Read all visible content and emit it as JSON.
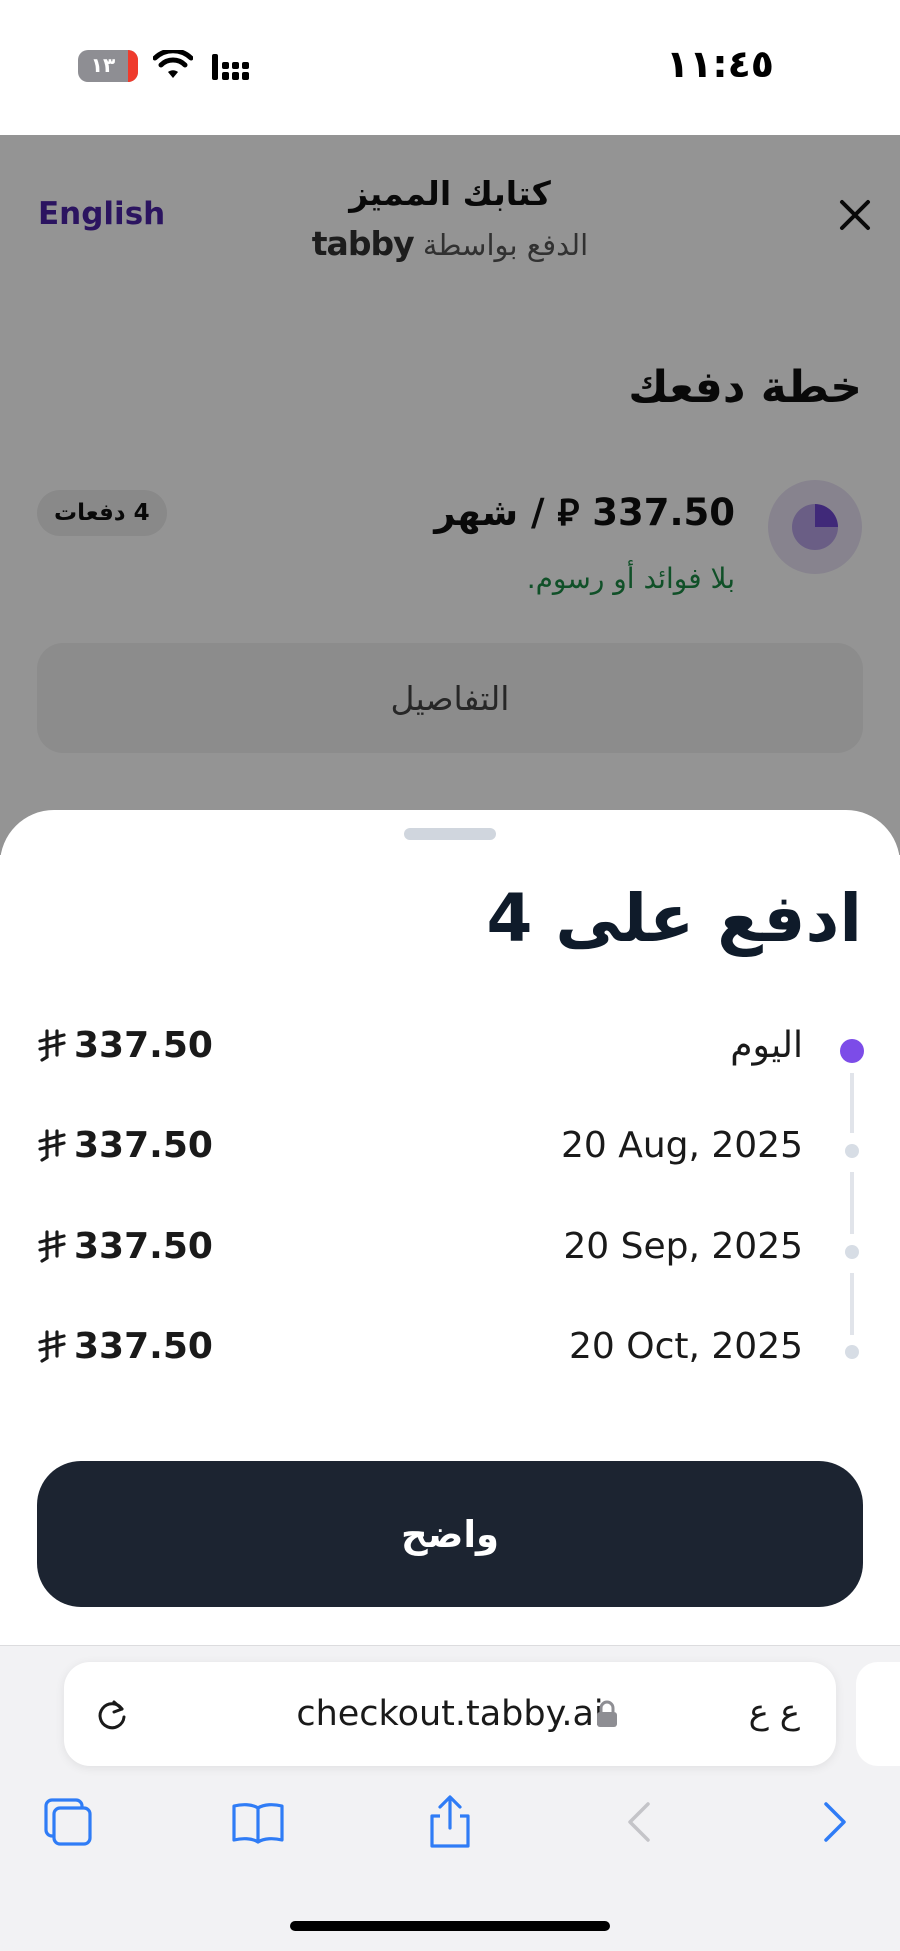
{
  "status_bar": {
    "time": "١١:٤٥",
    "battery": "١٣"
  },
  "checkout": {
    "language_link": "English",
    "store_title": "كتابك المميز",
    "pay_via": "الدفع بواسطة",
    "brand": "tabby",
    "plan_heading": "خطة دفعك",
    "amount_per_month": "337.50 ⃁ / شهر",
    "no_fees_note": "بلا فوائد أو رسوم.",
    "payments_badge": "4 دفعات",
    "details_button": "التفاصيل"
  },
  "sheet": {
    "title": "ادفع على 4",
    "installments": [
      {
        "date": "اليوم",
        "amount": "337.50",
        "active": true
      },
      {
        "date": "20 Aug, 2025",
        "amount": "337.50",
        "active": false
      },
      {
        "date": "20 Sep, 2025",
        "amount": "337.50",
        "active": false
      },
      {
        "date": "20 Oct, 2025",
        "amount": "337.50",
        "active": false
      }
    ],
    "confirm_button": "واضح"
  },
  "browser": {
    "url": "checkout.tabby.ai",
    "text_size_label": "ع ع"
  },
  "colors": {
    "accent_purple": "#7c4ce8",
    "brand_purple": "#4b23a6",
    "no_fees_green": "#1d8a46",
    "button_dark": "#1c2431"
  },
  "icons": [
    "close-icon",
    "pie-icon",
    "riyal-icon",
    "reload-icon",
    "lock-icon",
    "tabs-icon",
    "bookmarks-icon",
    "share-icon",
    "back-icon",
    "forward-icon",
    "wifi-icon",
    "signal-icon"
  ]
}
